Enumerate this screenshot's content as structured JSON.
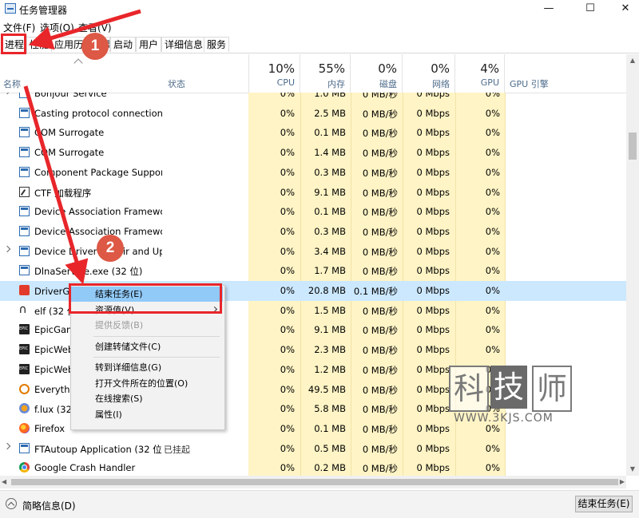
{
  "window": {
    "title": "任务管理器",
    "minimize_glyph": "—",
    "maximize_glyph": "☐",
    "close_glyph": "✕"
  },
  "menu": [
    "文件(F)",
    "选项(O)",
    "查看(V)"
  ],
  "tabs": [
    {
      "label": "进程",
      "active": true
    },
    {
      "label": "性能"
    },
    {
      "label": "应用历史记录"
    },
    {
      "label": "启动"
    },
    {
      "label": "用户"
    },
    {
      "label": "详细信息"
    },
    {
      "label": "服务"
    }
  ],
  "columns": {
    "name": "名称",
    "status": "状态",
    "cpu": {
      "percent": "10%",
      "label": "CPU"
    },
    "memory": {
      "percent": "55%",
      "label": "内存"
    },
    "disk": {
      "percent": "0%",
      "label": "磁盘"
    },
    "network": {
      "percent": "0%",
      "label": "网络"
    },
    "gpu": {
      "percent": "4%",
      "label": "GPU"
    },
    "gpu_engine": "GPU 引擎"
  },
  "rows": [
    {
      "name": "Bonjour Service",
      "status": "",
      "cpu": "0%",
      "mem": "1.0 MB",
      "disk": "0 MB/秒",
      "net": "0 Mbps",
      "gpu": "0%",
      "icon": "win",
      "expandable": true
    },
    {
      "name": "Casting protocol connection ...",
      "status": "",
      "cpu": "0%",
      "mem": "2.5 MB",
      "disk": "0 MB/秒",
      "net": "0 Mbps",
      "gpu": "0%",
      "icon": "win"
    },
    {
      "name": "COM Surrogate",
      "status": "",
      "cpu": "0%",
      "mem": "0.1 MB",
      "disk": "0 MB/秒",
      "net": "0 Mbps",
      "gpu": "0%",
      "icon": "win"
    },
    {
      "name": "COM Surrogate",
      "status": "",
      "cpu": "0%",
      "mem": "1.4 MB",
      "disk": "0 MB/秒",
      "net": "0 Mbps",
      "gpu": "0%",
      "icon": "win"
    },
    {
      "name": "Component Package Suppor...",
      "status": "",
      "cpu": "0%",
      "mem": "0.3 MB",
      "disk": "0 MB/秒",
      "net": "0 Mbps",
      "gpu": "0%",
      "icon": "win"
    },
    {
      "name": "CTF 加载程序",
      "status": "",
      "cpu": "0%",
      "mem": "9.1 MB",
      "disk": "0 MB/秒",
      "net": "0 Mbps",
      "gpu": "0%",
      "icon": "ctf"
    },
    {
      "name": "Device Association Framewo...",
      "status": "",
      "cpu": "0%",
      "mem": "0.1 MB",
      "disk": "0 MB/秒",
      "net": "0 Mbps",
      "gpu": "0%",
      "icon": "win"
    },
    {
      "name": "Device Association Framewo...",
      "status": "",
      "cpu": "0%",
      "mem": "0.3 MB",
      "disk": "0 MB/秒",
      "net": "0 Mbps",
      "gpu": "0%",
      "icon": "win"
    },
    {
      "name": "Device Driver Repair and Up...",
      "status": "",
      "cpu": "0%",
      "mem": "3.4 MB",
      "disk": "0 MB/秒",
      "net": "0 Mbps",
      "gpu": "0%",
      "icon": "win",
      "expandable": true
    },
    {
      "name": "DlnaService.exe (32 位)",
      "status": "",
      "cpu": "0%",
      "mem": "1.7 MB",
      "disk": "0 MB/秒",
      "net": "0 Mbps",
      "gpu": "0%",
      "icon": "win"
    },
    {
      "name": "DriverGenius Protect (32 位)",
      "status": "",
      "cpu": "0%",
      "mem": "20.8 MB",
      "disk": "0.1 MB/秒",
      "net": "0 Mbps",
      "gpu": "0%",
      "icon": "dg",
      "selected": true
    },
    {
      "name": "elf (32 位)",
      "status": "",
      "cpu": "0%",
      "mem": "1.5 MB",
      "disk": "0 MB/秒",
      "net": "0 Mbps",
      "gpu": "0%",
      "icon": "elf"
    },
    {
      "name": "EpicGamesLauncher",
      "status": "",
      "cpu": "0%",
      "mem": "9.1 MB",
      "disk": "0 MB/秒",
      "net": "0 Mbps",
      "gpu": "0%",
      "icon": "epic"
    },
    {
      "name": "EpicWebHelper",
      "status": "",
      "cpu": "0%",
      "mem": "2.3 MB",
      "disk": "0 MB/秒",
      "net": "0 Mbps",
      "gpu": "0%",
      "icon": "epic"
    },
    {
      "name": "EpicWebHelper",
      "status": "",
      "cpu": "0%",
      "mem": "1.2 MB",
      "disk": "0 MB/秒",
      "net": "0 Mbps",
      "gpu": "0%",
      "icon": "epic"
    },
    {
      "name": "Everything",
      "status": "",
      "cpu": "0%",
      "mem": "49.5 MB",
      "disk": "0 MB/秒",
      "net": "0 Mbps",
      "gpu": "0%",
      "icon": "every"
    },
    {
      "name": "f.lux (32 位)",
      "status": "",
      "cpu": "0%",
      "mem": "5.8 MB",
      "disk": "0 MB/秒",
      "net": "0 Mbps",
      "gpu": "0%",
      "icon": "flux"
    },
    {
      "name": "Firefox",
      "status": "",
      "cpu": "0%",
      "mem": "0.1 MB",
      "disk": "0 MB/秒",
      "net": "0 Mbps",
      "gpu": "0%",
      "icon": "firefox"
    },
    {
      "name": "FTAutoup Application (32 位)",
      "status": "已挂起",
      "cpu": "0%",
      "mem": "0.5 MB",
      "disk": "0 MB/秒",
      "net": "0 Mbps",
      "gpu": "0%",
      "icon": "win",
      "expandable": true
    },
    {
      "name": "Google Crash Handler",
      "status": "",
      "cpu": "0%",
      "mem": "0.2 MB",
      "disk": "0 MB/秒",
      "net": "0 Mbps",
      "gpu": "0%",
      "icon": "chrome"
    }
  ],
  "context_menu": [
    {
      "label": "结束任务(E)",
      "highlight": true
    },
    {
      "label": "资源值(V)",
      "submenu": true
    },
    {
      "label": "提供反馈(B)",
      "disabled": true
    },
    {
      "sep": true
    },
    {
      "label": "创建转储文件(C)"
    },
    {
      "sep": true
    },
    {
      "label": "转到详细信息(G)"
    },
    {
      "label": "打开文件所在的位置(O)"
    },
    {
      "label": "在线搜索(S)"
    },
    {
      "label": "属性(I)"
    }
  ],
  "footer": {
    "fewer_details": "简略信息(D)",
    "end_task": "结束任务(E)"
  },
  "annotations": {
    "badge1": "1",
    "badge2": "2",
    "arrow_color": "#e8262a"
  },
  "watermark": {
    "chars": [
      "科",
      "技",
      "师"
    ],
    "url": "WWW.3KJS.COM"
  }
}
